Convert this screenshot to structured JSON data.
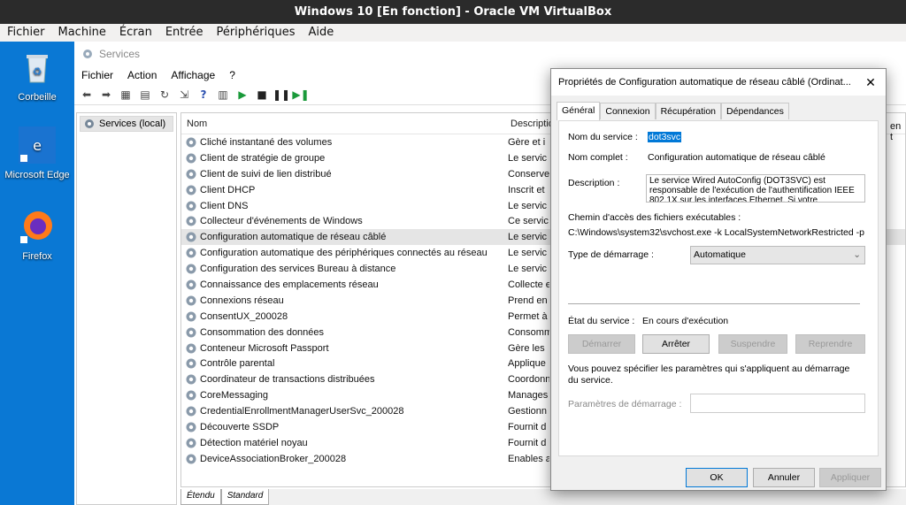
{
  "vbox": {
    "title": "Windows 10 [En fonction] - Oracle VM VirtualBox",
    "menu": [
      "Fichier",
      "Machine",
      "Écran",
      "Entrée",
      "Périphériques",
      "Aide"
    ]
  },
  "desktop": {
    "icons": [
      {
        "label": "Corbeille"
      },
      {
        "label": "Microsoft Edge"
      },
      {
        "label": "Firefox"
      }
    ]
  },
  "services": {
    "title": "Services",
    "menu": [
      "Fichier",
      "Action",
      "Affichage",
      "?"
    ],
    "tree_item": "Services (local)",
    "columns": {
      "name": "Nom",
      "description": "Descriptio"
    },
    "extra_text": "en t",
    "rows": [
      {
        "name": "Cliché instantané des volumes",
        "desc": "Gère et i"
      },
      {
        "name": "Client de stratégie de groupe",
        "desc": "Le servic"
      },
      {
        "name": "Client de suivi de lien distribué",
        "desc": "Conserve"
      },
      {
        "name": "Client DHCP",
        "desc": "Inscrit et"
      },
      {
        "name": "Client DNS",
        "desc": "Le servic"
      },
      {
        "name": "Collecteur d'événements de Windows",
        "desc": "Ce servic"
      },
      {
        "name": "Configuration automatique de réseau câblé",
        "desc": "Le servic"
      },
      {
        "name": "Configuration automatique des périphériques connectés au réseau",
        "desc": "Le servic"
      },
      {
        "name": "Configuration des services Bureau à distance",
        "desc": "Le servic"
      },
      {
        "name": "Connaissance des emplacements réseau",
        "desc": "Collecte e"
      },
      {
        "name": "Connexions réseau",
        "desc": "Prend en"
      },
      {
        "name": "ConsentUX_200028",
        "desc": "Permet à"
      },
      {
        "name": "Consommation des données",
        "desc": "Consomm"
      },
      {
        "name": "Conteneur Microsoft Passport",
        "desc": "Gère les"
      },
      {
        "name": "Contrôle parental",
        "desc": "Applique"
      },
      {
        "name": "Coordinateur de transactions distribuées",
        "desc": "Coordonn"
      },
      {
        "name": "CoreMessaging",
        "desc": "Manages"
      },
      {
        "name": "CredentialEnrollmentManagerUserSvc_200028",
        "desc": "Gestionn"
      },
      {
        "name": "Découverte SSDP",
        "desc": "Fournit d"
      },
      {
        "name": "Détection matériel noyau",
        "desc": "Fournit d"
      },
      {
        "name": "DeviceAssociationBroker_200028",
        "desc": "Enables a"
      }
    ],
    "bottom_tabs": [
      "Étendu",
      "Standard"
    ]
  },
  "dialog": {
    "title": "Propriétés de Configuration automatique de réseau câblé (Ordinat...",
    "tabs": [
      "Général",
      "Connexion",
      "Récupération",
      "Dépendances"
    ],
    "service_name_label": "Nom du service :",
    "service_name": "dot3svc",
    "display_name_label": "Nom complet :",
    "display_name": "Configuration automatique de réseau câblé",
    "description_label": "Description :",
    "description": "Le service Wired AutoConfig (DOT3SVC) est responsable de l'exécution de l'authentification IEEE 802.1X sur les interfaces Ethernet. Si votre",
    "path_label": "Chemin d'accès des fichiers exécutables :",
    "path": "C:\\Windows\\system32\\svchost.exe -k LocalSystemNetworkRestricted -p",
    "startup_label": "Type de démarrage :",
    "startup_value": "Automatique",
    "status_label": "État du service :",
    "status_value": "En cours d'exécution",
    "btn_start": "Démarrer",
    "btn_stop": "Arrêter",
    "btn_suspend": "Suspendre",
    "btn_resume": "Reprendre",
    "params_note": "Vous pouvez spécifier les paramètres qui s'appliquent au démarrage du service.",
    "params_label": "Paramètres de démarrage :",
    "btn_ok": "OK",
    "btn_cancel": "Annuler",
    "btn_apply": "Appliquer"
  }
}
